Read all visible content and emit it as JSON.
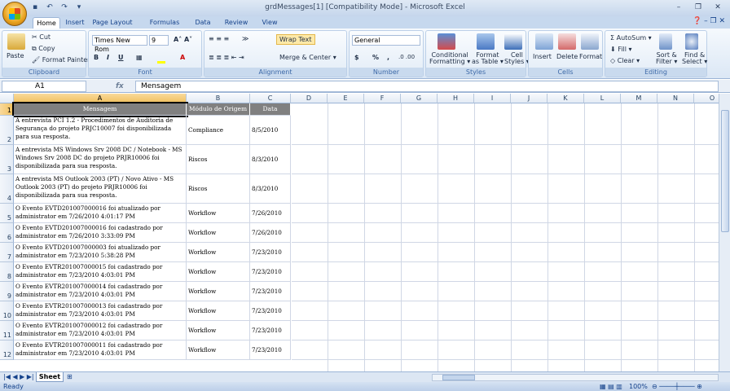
{
  "window": {
    "title": "grdMessages[1]  [Compatibility Mode] - Microsoft Excel"
  },
  "tabs": [
    "Home",
    "Insert",
    "Page Layout",
    "Formulas",
    "Data",
    "Review",
    "View"
  ],
  "ribbon": {
    "clipboard": {
      "label": "Clipboard",
      "paste": "Paste",
      "cut": "Cut",
      "copy": "Copy",
      "format_painter": "Format Painter"
    },
    "font": {
      "label": "Font",
      "name": "Times New Rom",
      "size": "9"
    },
    "alignment": {
      "label": "Alignment",
      "wrap_text": "Wrap Text",
      "merge_center": "Merge & Center"
    },
    "number": {
      "label": "Number",
      "format": "General",
      "currency": "$",
      "percent": "%",
      "comma": ","
    },
    "styles": {
      "label": "Styles",
      "conditional": "Conditional",
      "conditional2": "Formatting",
      "format_as": "Format",
      "format_as2": "as Table",
      "cell": "Cell",
      "cell2": "Styles"
    },
    "cells": {
      "label": "Cells",
      "insert": "Insert",
      "delete": "Delete",
      "format": "Format"
    },
    "editing": {
      "label": "Editing",
      "autosum": "AutoSum",
      "fill": "Fill",
      "clear": "Clear",
      "sort": "Sort &",
      "sort2": "Filter",
      "find": "Find &",
      "find2": "Select"
    }
  },
  "formula_bar": {
    "cell_ref": "A1",
    "fx": "fx",
    "content": "Mensagem"
  },
  "columns": [
    "A",
    "B",
    "C",
    "D",
    "E",
    "F",
    "G",
    "H",
    "I",
    "J",
    "K",
    "L",
    "M",
    "N",
    "O"
  ],
  "header_row": {
    "a": "Mensagem",
    "b": "Módulo de Origem",
    "c": "Data"
  },
  "rows": [
    {
      "num": "2",
      "msg": "A entrevista PCI 1.2 - Procedimentos de Auditoria de Segurança do projeto PRJC10007 foi disponibilizada para sua resposta.",
      "module": "Compliance",
      "date": "8/5/2010"
    },
    {
      "num": "3",
      "msg": "A entrevista MS Windows Srv 2008 DC / Notebook - MS Windows Srv 2008 DC do projeto PRJR10006 foi disponibilizada para sua resposta.",
      "module": "Riscos",
      "date": "8/3/2010"
    },
    {
      "num": "4",
      "msg": "A entrevista MS Outlook 2003 (PT) / Novo Ativo - MS Outlook 2003 (PT) do projeto PRJR10006 foi disponibilizada para sua resposta.",
      "module": "Riscos",
      "date": "8/3/2010"
    },
    {
      "num": "5",
      "msg": "O Evento EVTD201007000016 foi atualizado por administrator em 7/26/2010 4:01:17 PM",
      "module": "Workflow",
      "date": "7/26/2010"
    },
    {
      "num": "6",
      "msg": "O Evento EVTD201007000016 foi cadastrado por administrator em 7/26/2010 3:33:09 PM",
      "module": "Workflow",
      "date": "7/26/2010"
    },
    {
      "num": "7",
      "msg": "O Evento EVTD201007000003 foi atualizado por administrator em 7/23/2010 5:38:28 PM",
      "module": "Workflow",
      "date": "7/23/2010"
    },
    {
      "num": "8",
      "msg": "O Evento EVTR201007000015 foi cadastrado por administrator em 7/23/2010 4:03:01 PM",
      "module": "Workflow",
      "date": "7/23/2010"
    },
    {
      "num": "9",
      "msg": "O Evento EVTR201007000014 foi cadastrado por administrator em 7/23/2010 4:03:01 PM",
      "module": "Workflow",
      "date": "7/23/2010"
    },
    {
      "num": "10",
      "msg": "O Evento EVTR201007000013 foi cadastrado por administrator em 7/23/2010 4:03:01 PM",
      "module": "Workflow",
      "date": "7/23/2010"
    },
    {
      "num": "11",
      "msg": "O Evento EVTR201007000012 foi cadastrado por administrator em 7/23/2010 4:03:01 PM",
      "module": "Workflow",
      "date": "7/23/2010"
    },
    {
      "num": "12",
      "msg": "O Evento EVTR201007000011 foi cadastrado por administrator em 7/23/2010 4:03:01 PM",
      "module": "Workflow",
      "date": "7/23/2010"
    }
  ],
  "sheet_tab": "Sheet",
  "status": {
    "ready": "Ready",
    "zoom": "100%"
  }
}
